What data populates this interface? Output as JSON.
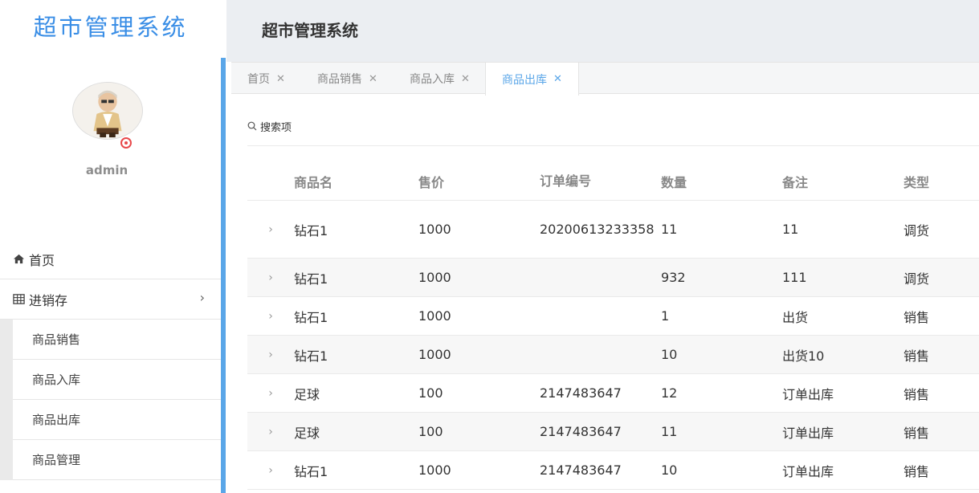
{
  "app": {
    "logo": "超市管理系统",
    "header_title": "超市管理系统"
  },
  "user": {
    "name": "admin"
  },
  "nav": {
    "home": "首页",
    "inventory": "进销存",
    "sub": [
      "商品销售",
      "商品入库",
      "商品出库",
      "商品管理"
    ]
  },
  "tabs": [
    {
      "label": "首页"
    },
    {
      "label": "商品销售"
    },
    {
      "label": "商品入库"
    },
    {
      "label": "商品出库",
      "active": true
    }
  ],
  "search": {
    "label": "搜索项"
  },
  "table": {
    "headers": [
      "商品名",
      "售价",
      "订单编号",
      "数量",
      "备注",
      "类型"
    ],
    "rows": [
      [
        "钻石1",
        "1000",
        "20200613233358",
        "11",
        "11",
        "调货"
      ],
      [
        "钻石1",
        "1000",
        "",
        "932",
        "111",
        "调货"
      ],
      [
        "钻石1",
        "1000",
        "",
        "1",
        "出货",
        "销售"
      ],
      [
        "钻石1",
        "1000",
        "",
        "10",
        "出货10",
        "销售"
      ],
      [
        "足球",
        "100",
        "2147483647",
        "12",
        "订单出库",
        "销售"
      ],
      [
        "足球",
        "100",
        "2147483647",
        "11",
        "订单出库",
        "销售"
      ],
      [
        "钻石1",
        "1000",
        "2147483647",
        "10",
        "订单出库",
        "销售"
      ]
    ]
  },
  "colors": {
    "accent": "#5aa6e8",
    "logo": "#3a8ee6",
    "header_bg": "#ebeef2",
    "status": "#e8494b"
  }
}
